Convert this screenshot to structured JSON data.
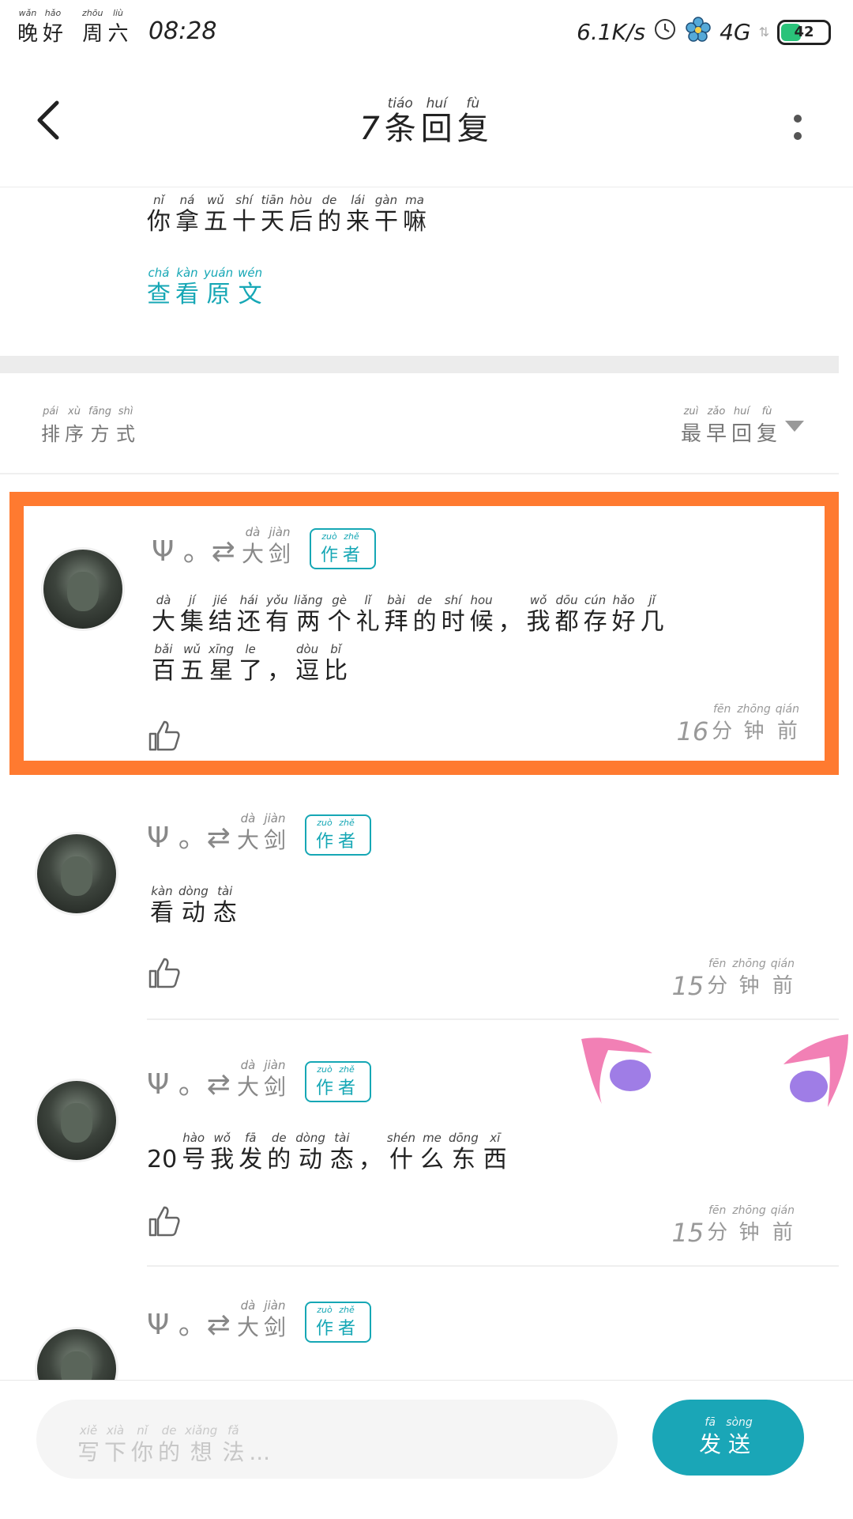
{
  "status_bar": {
    "greeting": [
      {
        "p": "wǎn",
        "c": "晚"
      },
      {
        "p": "hǎo",
        "c": "好"
      }
    ],
    "weekday": [
      {
        "p": "zhōu",
        "c": "周"
      },
      {
        "p": "liù",
        "c": "六"
      }
    ],
    "time": "08:28",
    "net_speed": "6.1K/s",
    "network": "4G",
    "battery": "42"
  },
  "header": {
    "count": "7",
    "title": [
      {
        "p": "tiáo",
        "c": "条"
      },
      {
        "p": "huí",
        "c": "回"
      },
      {
        "p": "fù",
        "c": "复"
      }
    ]
  },
  "quote": {
    "text": [
      {
        "p": "nǐ",
        "c": "你"
      },
      {
        "p": "ná",
        "c": "拿"
      },
      {
        "p": "wǔ",
        "c": "五"
      },
      {
        "p": "shí",
        "c": "十"
      },
      {
        "p": "tiān",
        "c": "天"
      },
      {
        "p": "hòu",
        "c": "后"
      },
      {
        "p": "de",
        "c": "的"
      },
      {
        "p": "lái",
        "c": "来"
      },
      {
        "p": "gàn",
        "c": "干"
      },
      {
        "p": "ma",
        "c": "嘛"
      }
    ],
    "view_original": [
      {
        "p": "chá",
        "c": "查"
      },
      {
        "p": "kàn",
        "c": "看"
      },
      {
        "p": "yuán",
        "c": "原"
      },
      {
        "p": "wén",
        "c": "文"
      }
    ]
  },
  "sort": {
    "label": [
      {
        "p": "pái",
        "c": "排"
      },
      {
        "p": "xù",
        "c": "序"
      },
      {
        "p": "fāng",
        "c": "方"
      },
      {
        "p": "shì",
        "c": "式"
      }
    ],
    "value": [
      {
        "p": "zuì",
        "c": "最"
      },
      {
        "p": "zǎo",
        "c": "早"
      },
      {
        "p": "huí",
        "c": "回"
      },
      {
        "p": "fù",
        "c": "复"
      }
    ]
  },
  "user": {
    "prefix": "Ψ 。⇄",
    "name": [
      {
        "p": "dà",
        "c": "大"
      },
      {
        "p": "jiàn",
        "c": "剑"
      }
    ],
    "badge": [
      {
        "p": "zuò",
        "c": "作"
      },
      {
        "p": "zhě",
        "c": "者"
      }
    ]
  },
  "comments": [
    {
      "lines": [
        [
          {
            "p": "dà",
            "c": "大"
          },
          {
            "p": "jí",
            "c": "集"
          },
          {
            "p": "jié",
            "c": "结"
          },
          {
            "p": "hái",
            "c": "还"
          },
          {
            "p": "yǒu",
            "c": "有"
          },
          {
            "p": "liǎng",
            "c": "两"
          },
          {
            "p": "gè",
            "c": "个"
          },
          {
            "p": "lǐ",
            "c": "礼"
          },
          {
            "p": "bài",
            "c": "拜"
          },
          {
            "p": "de",
            "c": "的"
          },
          {
            "p": "shí",
            "c": "时"
          },
          {
            "p": "hou",
            "c": "候"
          },
          {
            "p": "",
            "c": "，"
          },
          {
            "p": "wǒ",
            "c": "我"
          },
          {
            "p": "dōu",
            "c": "都"
          },
          {
            "p": "cún",
            "c": "存"
          },
          {
            "p": "hǎo",
            "c": "好"
          },
          {
            "p": "jǐ",
            "c": "几"
          }
        ],
        [
          {
            "p": "bǎi",
            "c": "百"
          },
          {
            "p": "wǔ",
            "c": "五"
          },
          {
            "p": "xīng",
            "c": "星"
          },
          {
            "p": "le",
            "c": "了"
          },
          {
            "p": "",
            "c": "，"
          },
          {
            "p": "dòu",
            "c": "逗"
          },
          {
            "p": "bǐ",
            "c": "比"
          }
        ]
      ],
      "time_num": "16",
      "time_unit": [
        {
          "p": "fēn",
          "c": "分"
        },
        {
          "p": "zhōng",
          "c": "钟"
        },
        {
          "p": "qián",
          "c": "前"
        }
      ]
    },
    {
      "lines": [
        [
          {
            "p": "kàn",
            "c": "看"
          },
          {
            "p": "dòng",
            "c": "动"
          },
          {
            "p": "tài",
            "c": "态"
          }
        ]
      ],
      "time_num": "15",
      "time_unit": [
        {
          "p": "fēn",
          "c": "分"
        },
        {
          "p": "zhōng",
          "c": "钟"
        },
        {
          "p": "qián",
          "c": "前"
        }
      ]
    },
    {
      "lines": [
        [
          {
            "p": "",
            "c": "20"
          },
          {
            "p": "hào",
            "c": "号"
          },
          {
            "p": "wǒ",
            "c": "我"
          },
          {
            "p": "fā",
            "c": "发"
          },
          {
            "p": "de",
            "c": "的"
          },
          {
            "p": "dòng",
            "c": "动"
          },
          {
            "p": "tài",
            "c": "态"
          },
          {
            "p": "",
            "c": "，"
          },
          {
            "p": "shén",
            "c": "什"
          },
          {
            "p": "me",
            "c": "么"
          },
          {
            "p": "dōng",
            "c": "东"
          },
          {
            "p": "xī",
            "c": "西"
          }
        ]
      ],
      "time_num": "15",
      "time_unit": [
        {
          "p": "fēn",
          "c": "分"
        },
        {
          "p": "zhōng",
          "c": "钟"
        },
        {
          "p": "qián",
          "c": "前"
        }
      ]
    }
  ],
  "input": {
    "placeholder": [
      {
        "p": "xiě",
        "c": "写"
      },
      {
        "p": "xià",
        "c": "下"
      },
      {
        "p": "nǐ",
        "c": "你"
      },
      {
        "p": "de",
        "c": "的"
      },
      {
        "p": "xiǎng",
        "c": "想"
      },
      {
        "p": "fǎ",
        "c": "法"
      },
      {
        "p": "",
        "c": "..."
      }
    ],
    "send": [
      {
        "p": "fā",
        "c": "发"
      },
      {
        "p": "sòng",
        "c": "送"
      }
    ]
  },
  "colors": {
    "accent": "#16a7b5",
    "highlight": "#ff7a30",
    "ear_pink": "#f06aa8",
    "ear_purple": "#9f7de6"
  },
  "icons": [
    "back-arrow-icon",
    "more-vert-icon",
    "thumbs-up-icon",
    "caret-down-icon",
    "clock-icon",
    "flower-icon",
    "signal-arrows-icon"
  ]
}
